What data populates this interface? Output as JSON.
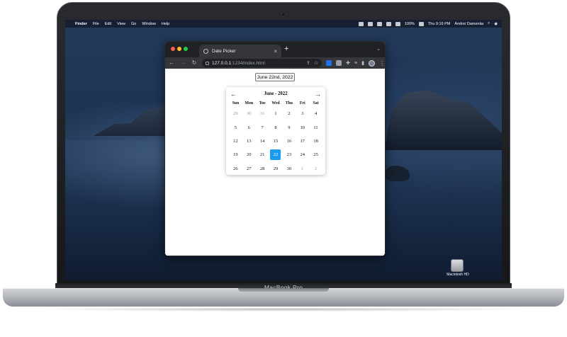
{
  "menubar": {
    "app": "Finder",
    "items": [
      "File",
      "Edit",
      "View",
      "Go",
      "Window",
      "Help"
    ],
    "battery": "100%",
    "datetime": "Thu 9:16 PM",
    "user": "Andrei Dameniia"
  },
  "desktop": {
    "disk_label": "Macintosh HD"
  },
  "browser": {
    "tab_title": "Date Picker",
    "url_host": "127.0.0.1",
    "url_path": ":1234/index.html"
  },
  "datepicker": {
    "value": "June 22nd, 2022",
    "month_label": "June - 2022",
    "prev_label": "←",
    "next_label": "→",
    "weekdays": [
      "Sun",
      "Mon",
      "Tue",
      "Wed",
      "Thu",
      "Fri",
      "Sat"
    ],
    "weeks": [
      [
        "29",
        "30",
        "31",
        "1",
        "2",
        "3",
        "4"
      ],
      [
        "5",
        "6",
        "7",
        "8",
        "9",
        "10",
        "11"
      ],
      [
        "12",
        "13",
        "14",
        "15",
        "16",
        "17",
        "18"
      ],
      [
        "19",
        "20",
        "21",
        "22",
        "23",
        "24",
        "25"
      ],
      [
        "26",
        "27",
        "28",
        "29",
        "30",
        "1",
        "2"
      ]
    ],
    "selected": "22",
    "selected_color": "#1a9bf0"
  },
  "device": {
    "model": "MacBook Pro"
  }
}
